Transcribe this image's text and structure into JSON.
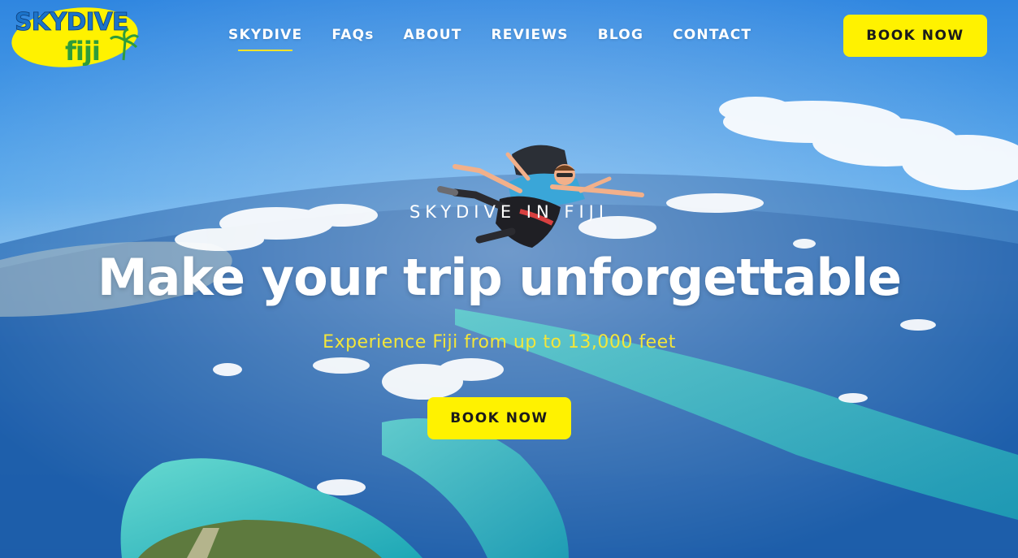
{
  "brand": {
    "logo_line1": "SKYDIVE",
    "logo_line2": "fiji"
  },
  "nav": {
    "items": [
      {
        "label": "SKYDIVE",
        "active": true
      },
      {
        "label": "FAQs",
        "active": false
      },
      {
        "label": "ABOUT",
        "active": false
      },
      {
        "label": "REVIEWS",
        "active": false
      },
      {
        "label": "BLOG",
        "active": false
      },
      {
        "label": "CONTACT",
        "active": false
      }
    ],
    "book_label": "BOOK NOW"
  },
  "hero": {
    "eyebrow": "SKYDIVE IN FIJI",
    "headline": "Make your trip unforgettable",
    "subhead": "Experience Fiji from up to 13,000 feet",
    "cta_label": "BOOK NOW"
  },
  "colors": {
    "accent": "#fff200",
    "sky": "#3f8fd6",
    "ocean": "#0f4f9e",
    "reef": "#3fc6c4"
  }
}
